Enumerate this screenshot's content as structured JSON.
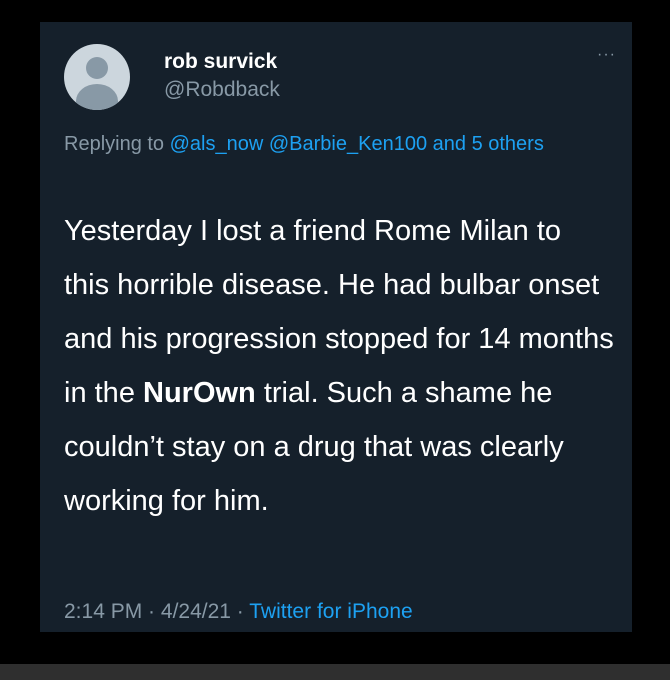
{
  "tweet": {
    "author_name": "rob survick",
    "author_handle": "@Robdback",
    "more_icon": "···",
    "reply_prefix": "Replying to ",
    "reply_mention_1": "@als_now",
    "reply_mention_2": "@Barbie_Ken100",
    "reply_and": " and ",
    "reply_others": "5 others",
    "text_part1": "Yesterday I lost a friend Rome Milan to this horrible disease. He had bulbar onset and his progression stopped for 14 months in the ",
    "text_bold": "NurOwn",
    "text_part2": " trial. Such a shame he couldn’t stay on a drug that was clearly working for him.",
    "time": "2:14 PM",
    "sep1": " · ",
    "date": "4/24/21",
    "sep2": " · ",
    "source": "Twitter for iPhone"
  },
  "colors": {
    "background": "#15202b",
    "link": "#1da1f2",
    "secondary_text": "#8899a6"
  }
}
